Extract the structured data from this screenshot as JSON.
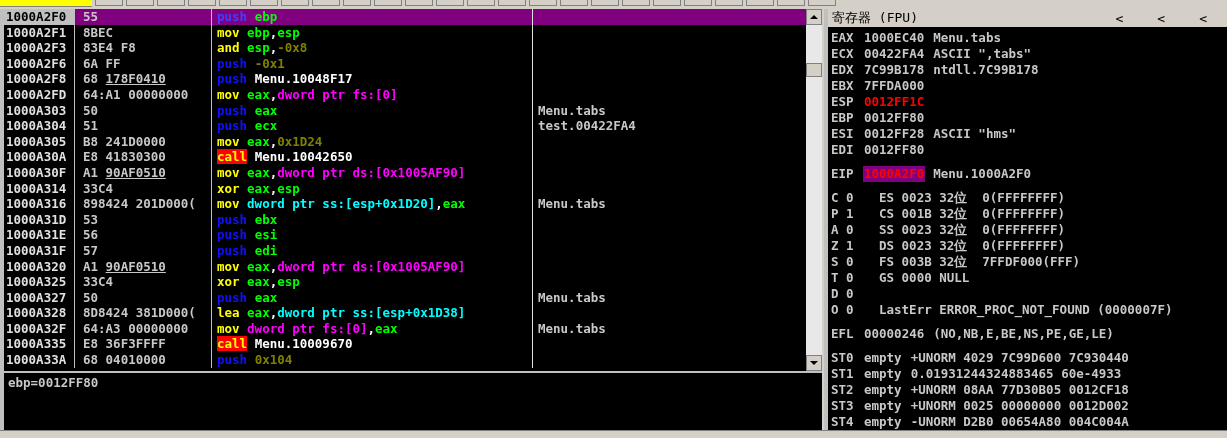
{
  "disassembly": {
    "rows": [
      {
        "address": "1000A2F0",
        "hex": "55",
        "selected": true,
        "code": [
          {
            "kind": "push",
            "text": "push"
          },
          {
            "kind": "reg",
            "text": "ebp"
          }
        ]
      },
      {
        "address": "1000A2F1",
        "hex": "8BEC",
        "selected": false,
        "code": [
          {
            "kind": "op",
            "text": "mov"
          },
          {
            "kind": "reg",
            "text": "ebp"
          },
          {
            "kind": "punct",
            "text": ","
          },
          {
            "kind": "reg",
            "text": "esp"
          }
        ]
      },
      {
        "address": "1000A2F3",
        "hex": "83E4 F8",
        "selected": false,
        "code": [
          {
            "kind": "op",
            "text": "and"
          },
          {
            "kind": "reg",
            "text": "esp"
          },
          {
            "kind": "punct",
            "text": ","
          },
          {
            "kind": "const",
            "text": "-0x8"
          }
        ]
      },
      {
        "address": "1000A2F6",
        "hex": "6A FF",
        "selected": false,
        "code": [
          {
            "kind": "push",
            "text": "push"
          },
          {
            "kind": "const",
            "text": "-0x1"
          }
        ]
      },
      {
        "address": "1000A2F8",
        "hex": "68",
        "fixup": "178F0410",
        "selected": false,
        "code": [
          {
            "kind": "push",
            "text": "push"
          },
          {
            "kind": "sym",
            "text": "Menu.10048F17"
          }
        ]
      },
      {
        "address": "1000A2FD",
        "hex": "64:A1 00000000",
        "selected": false,
        "code": [
          {
            "kind": "op",
            "text": "mov"
          },
          {
            "kind": "reg",
            "text": "eax"
          },
          {
            "kind": "punct",
            "text": ","
          },
          {
            "kind": "mem",
            "text": "dword ptr fs:[0]"
          }
        ]
      },
      {
        "address": "1000A303",
        "hex": "50",
        "selected": false,
        "code": [
          {
            "kind": "push",
            "text": "push"
          },
          {
            "kind": "reg",
            "text": "eax"
          }
        ],
        "comment": "Menu.tabs"
      },
      {
        "address": "1000A304",
        "hex": "51",
        "selected": false,
        "code": [
          {
            "kind": "push",
            "text": "push"
          },
          {
            "kind": "reg",
            "text": "ecx"
          }
        ],
        "comment": "test.00422FA4"
      },
      {
        "address": "1000A305",
        "hex": "B8 241D0000",
        "selected": false,
        "code": [
          {
            "kind": "op",
            "text": "mov"
          },
          {
            "kind": "reg",
            "text": "eax"
          },
          {
            "kind": "punct",
            "text": ","
          },
          {
            "kind": "const",
            "text": "0x1D24"
          }
        ]
      },
      {
        "address": "1000A30A",
        "hex": "E8 41830300",
        "selected": false,
        "code": [
          {
            "kind": "call",
            "text": "call"
          },
          {
            "kind": "sym",
            "text": "Menu.10042650"
          }
        ]
      },
      {
        "address": "1000A30F",
        "hex": "A1",
        "fixup": "90AF0510",
        "selected": false,
        "code": [
          {
            "kind": "op",
            "text": "mov"
          },
          {
            "kind": "reg",
            "text": "eax"
          },
          {
            "kind": "punct",
            "text": ","
          },
          {
            "kind": "mem",
            "text": "dword ptr ds:[0x1005AF90]"
          }
        ]
      },
      {
        "address": "1000A314",
        "hex": "33C4",
        "selected": false,
        "code": [
          {
            "kind": "op",
            "text": "xor"
          },
          {
            "kind": "reg",
            "text": "eax"
          },
          {
            "kind": "punct",
            "text": ","
          },
          {
            "kind": "reg",
            "text": "esp"
          }
        ]
      },
      {
        "address": "1000A316",
        "hex": "898424 201D000(",
        "selected": false,
        "code": [
          {
            "kind": "op",
            "text": "mov"
          },
          {
            "kind": "stack",
            "text": "dword ptr ss:[esp+0x1D20]"
          },
          {
            "kind": "punct",
            "text": ","
          },
          {
            "kind": "reg",
            "text": "eax"
          }
        ],
        "comment": "Menu.tabs"
      },
      {
        "address": "1000A31D",
        "hex": "53",
        "selected": false,
        "code": [
          {
            "kind": "push",
            "text": "push"
          },
          {
            "kind": "reg",
            "text": "ebx"
          }
        ]
      },
      {
        "address": "1000A31E",
        "hex": "56",
        "selected": false,
        "code": [
          {
            "kind": "push",
            "text": "push"
          },
          {
            "kind": "reg",
            "text": "esi"
          }
        ]
      },
      {
        "address": "1000A31F",
        "hex": "57",
        "selected": false,
        "code": [
          {
            "kind": "push",
            "text": "push"
          },
          {
            "kind": "reg",
            "text": "edi"
          }
        ]
      },
      {
        "address": "1000A320",
        "hex": "A1",
        "fixup": "90AF0510",
        "selected": false,
        "code": [
          {
            "kind": "op",
            "text": "mov"
          },
          {
            "kind": "reg",
            "text": "eax"
          },
          {
            "kind": "punct",
            "text": ","
          },
          {
            "kind": "mem",
            "text": "dword ptr ds:[0x1005AF90]"
          }
        ]
      },
      {
        "address": "1000A325",
        "hex": "33C4",
        "selected": false,
        "code": [
          {
            "kind": "op",
            "text": "xor"
          },
          {
            "kind": "reg",
            "text": "eax"
          },
          {
            "kind": "punct",
            "text": ","
          },
          {
            "kind": "reg",
            "text": "esp"
          }
        ]
      },
      {
        "address": "1000A327",
        "hex": "50",
        "selected": false,
        "code": [
          {
            "kind": "push",
            "text": "push"
          },
          {
            "kind": "reg",
            "text": "eax"
          }
        ],
        "comment": "Menu.tabs"
      },
      {
        "address": "1000A328",
        "hex": "8D8424 381D000(",
        "selected": false,
        "code": [
          {
            "kind": "op",
            "text": "lea"
          },
          {
            "kind": "reg",
            "text": "eax"
          },
          {
            "kind": "punct",
            "text": ","
          },
          {
            "kind": "stack",
            "text": "dword ptr ss:[esp+0x1D38]"
          }
        ]
      },
      {
        "address": "1000A32F",
        "hex": "64:A3 00000000",
        "selected": false,
        "code": [
          {
            "kind": "op",
            "text": "mov"
          },
          {
            "kind": "mem",
            "text": "dword ptr fs:[0]"
          },
          {
            "kind": "punct",
            "text": ","
          },
          {
            "kind": "reg",
            "text": "eax"
          }
        ],
        "comment": "Menu.tabs"
      },
      {
        "address": "1000A335",
        "hex": "E8 36F3FFFF",
        "selected": false,
        "code": [
          {
            "kind": "call",
            "text": "call"
          },
          {
            "kind": "sym",
            "text": "Menu.10009670"
          }
        ]
      },
      {
        "address": "1000A33A",
        "hex": "68 04010000",
        "selected": false,
        "code": [
          {
            "kind": "push",
            "text": "push"
          },
          {
            "kind": "const",
            "text": "0x104"
          }
        ]
      }
    ]
  },
  "info": "ebp=0012FF80",
  "registers": {
    "title": "寄存器 (FPU)",
    "nav": [
      "<",
      "<",
      "<"
    ],
    "groups": [
      [
        {
          "kind": "reg",
          "name": "EAX",
          "value": "1000EC40",
          "comment": "Menu.tabs",
          "changed": false,
          "highlighted": false
        },
        {
          "kind": "reg",
          "name": "ECX",
          "value": "00422FA4",
          "comment": "ASCII \",tabs\"",
          "changed": false,
          "highlighted": false
        },
        {
          "kind": "reg",
          "name": "EDX",
          "value": "7C99B178",
          "comment": "ntdll.7C99B178",
          "changed": false,
          "highlighted": false
        },
        {
          "kind": "reg",
          "name": "EBX",
          "value": "7FFDA000",
          "changed": false,
          "highlighted": false
        },
        {
          "kind": "reg",
          "name": "ESP",
          "value": "0012FF1C",
          "changed": true,
          "highlighted": false
        },
        {
          "kind": "reg",
          "name": "EBP",
          "value": "0012FF80",
          "changed": false,
          "highlighted": false
        },
        {
          "kind": "reg",
          "name": "ESI",
          "value": "0012FF28",
          "comment": "ASCII \"hms\"",
          "changed": false,
          "highlighted": false
        },
        {
          "kind": "reg",
          "name": "EDI",
          "value": "0012FF80",
          "changed": false,
          "highlighted": false
        }
      ],
      [
        {
          "kind": "reg",
          "name": "EIP",
          "value": "1000A2F0",
          "comment": "Menu.1000A2F0",
          "changed": true,
          "highlighted": true
        }
      ],
      [
        {
          "kind": "flag",
          "name": "C 0",
          "detail": "ES 0023 32位  0(FFFFFFFF)"
        },
        {
          "kind": "flag",
          "name": "P 1",
          "detail": "CS 001B 32位  0(FFFFFFFF)"
        },
        {
          "kind": "flag",
          "name": "A 0",
          "detail": "SS 0023 32位  0(FFFFFFFF)"
        },
        {
          "kind": "flag",
          "name": "Z 1",
          "detail": "DS 0023 32位  0(FFFFFFFF)"
        },
        {
          "kind": "flag",
          "name": "S 0",
          "detail": "FS 003B 32位  7FFDF000(FFF)"
        },
        {
          "kind": "flag",
          "name": "T 0",
          "detail": "GS 0000 NULL"
        },
        {
          "kind": "flag",
          "name": "D 0"
        },
        {
          "kind": "flag",
          "name": "O 0",
          "detail": "LastErr ERROR_PROC_NOT_FOUND (0000007F)"
        }
      ],
      [
        {
          "kind": "reg",
          "name": "EFL",
          "value": "00000246",
          "comment": "(NO,NB,E,BE,NS,PE,GE,LE)",
          "changed": false,
          "highlighted": false
        }
      ],
      [
        {
          "kind": "fpu",
          "name": "ST0",
          "value": "empty",
          "comment": "+UNORM 4029 7C99D600 7C930440"
        },
        {
          "kind": "fpu",
          "name": "ST1",
          "value": "empty",
          "comment": "0.01931244324883465 60e-4933"
        },
        {
          "kind": "fpu",
          "name": "ST2",
          "value": "empty",
          "comment": "+UNORM 08AA 77D30B05 0012CF18"
        },
        {
          "kind": "fpu",
          "name": "ST3",
          "value": "empty",
          "comment": "+UNORM 0025 00000000 0012D002"
        },
        {
          "kind": "fpu",
          "name": "ST4",
          "value": "empty",
          "comment": "-UNORM D2B0 00654A80 004C004A"
        }
      ]
    ]
  }
}
